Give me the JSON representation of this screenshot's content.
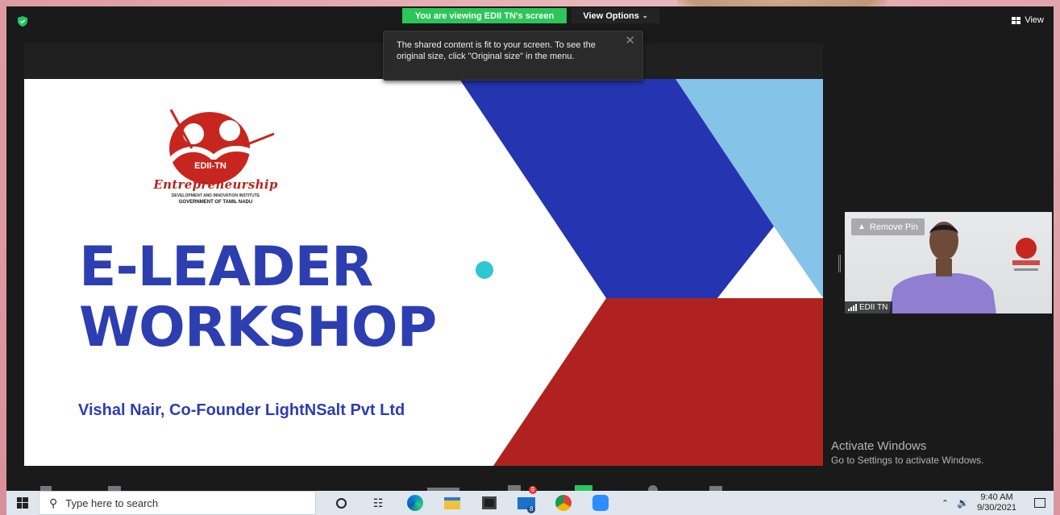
{
  "top_bar": {
    "viewing_banner": "You are viewing EDII TN's screen",
    "view_options_label": "View Options",
    "view_button_label": "View"
  },
  "tooltip": {
    "text": "The shared content is fit to your screen. To see the original size, click \"Original size\" in the menu."
  },
  "slide": {
    "logo_badge": "EDII-TN",
    "logo_script": "Entrepreneurship",
    "logo_sub1": "DEVELOPMENT AND INNOVATION INSTITUTE",
    "logo_sub2": "GOVERNMENT OF TAMIL NADU",
    "title_line1": "E-LEADER",
    "title_line2": "WORKSHOP",
    "presenter": "Vishal Nair, Co-Founder LightNSalt Pvt Ltd",
    "colors": {
      "blue": "#2534b0",
      "light_blue": "#85c3e9",
      "red": "#b0221f",
      "dot": "#2ec7d3",
      "title": "#2c3eb0"
    }
  },
  "video_tile": {
    "remove_pin_label": "Remove Pin",
    "participant_name": "EDII TN"
  },
  "watermark": {
    "title": "Activate Windows",
    "subtitle": "Go to Settings to activate Windows."
  },
  "taskbar": {
    "search_placeholder": "Type here to search",
    "mail_badge": "8",
    "store_badge": "9",
    "time": "9:40 AM",
    "date": "9/30/2021"
  }
}
